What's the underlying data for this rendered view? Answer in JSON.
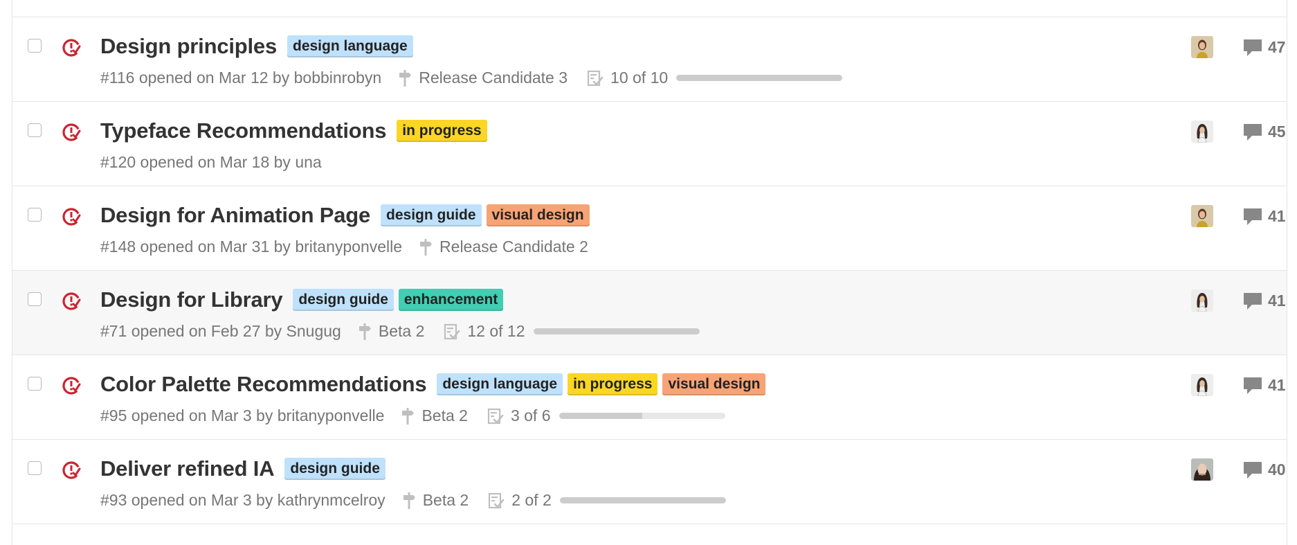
{
  "colors": {
    "issue_icon": "#cb2431",
    "label_design_language": "#bfe1fb",
    "label_in_progress": "#fbd624",
    "label_visual_design": "#f7a375",
    "label_design_guide": "#bfe1fb",
    "label_enhancement": "#3fcfb3"
  },
  "issues": [
    {
      "title": "Design principles",
      "labels": [
        {
          "text": "design language",
          "color": "#bfe1fb"
        }
      ],
      "number_text": "#116 opened on Mar 12 by bobbinrobyn",
      "milestone": "Release Candidate 3",
      "tasks": "10 of 10",
      "tasks_done_fraction": 1.0,
      "comments": "47",
      "avatar": "avatar-yellow-top",
      "hover": false
    },
    {
      "title": "Typeface Recommendations",
      "labels": [
        {
          "text": "in progress",
          "color": "#fbd624"
        }
      ],
      "number_text": "#120 opened on Mar 18 by una",
      "milestone": "",
      "tasks": "",
      "tasks_done_fraction": null,
      "comments": "45",
      "avatar": "avatar-dark-hair",
      "hover": false
    },
    {
      "title": "Design for Animation Page",
      "labels": [
        {
          "text": "design guide",
          "color": "#bfe1fb"
        },
        {
          "text": "visual design",
          "color": "#f7a375"
        }
      ],
      "number_text": "#148 opened on Mar 31 by britanyponvelle",
      "milestone": "Release Candidate 2",
      "tasks": "",
      "tasks_done_fraction": null,
      "comments": "41",
      "avatar": "avatar-yellow-top",
      "hover": false
    },
    {
      "title": "Design for Library",
      "labels": [
        {
          "text": "design guide",
          "color": "#bfe1fb"
        },
        {
          "text": "enhancement",
          "color": "#3fcfb3"
        }
      ],
      "number_text": "#71 opened on Feb 27 by Snugug",
      "milestone": "Beta 2",
      "tasks": "12 of 12",
      "tasks_done_fraction": 1.0,
      "comments": "41",
      "avatar": "avatar-dark-hair",
      "hover": true
    },
    {
      "title": "Color Palette Recommendations",
      "labels": [
        {
          "text": "design language",
          "color": "#bfe1fb"
        },
        {
          "text": "in progress",
          "color": "#fbd624"
        },
        {
          "text": "visual design",
          "color": "#f7a375"
        }
      ],
      "number_text": "#95 opened on Mar 3 by britanyponvelle",
      "milestone": "Beta 2",
      "tasks": "3 of 6",
      "tasks_done_fraction": 0.5,
      "comments": "41",
      "avatar": "avatar-dark-hair",
      "hover": false
    },
    {
      "title": "Deliver refined IA",
      "labels": [
        {
          "text": "design guide",
          "color": "#bfe1fb"
        }
      ],
      "number_text": "#93 opened on Mar 3 by kathrynmcelroy",
      "milestone": "Beta 2",
      "tasks": "2 of 2",
      "tasks_done_fraction": 1.0,
      "comments": "40",
      "avatar": "avatar-brunette",
      "hover": false
    }
  ]
}
